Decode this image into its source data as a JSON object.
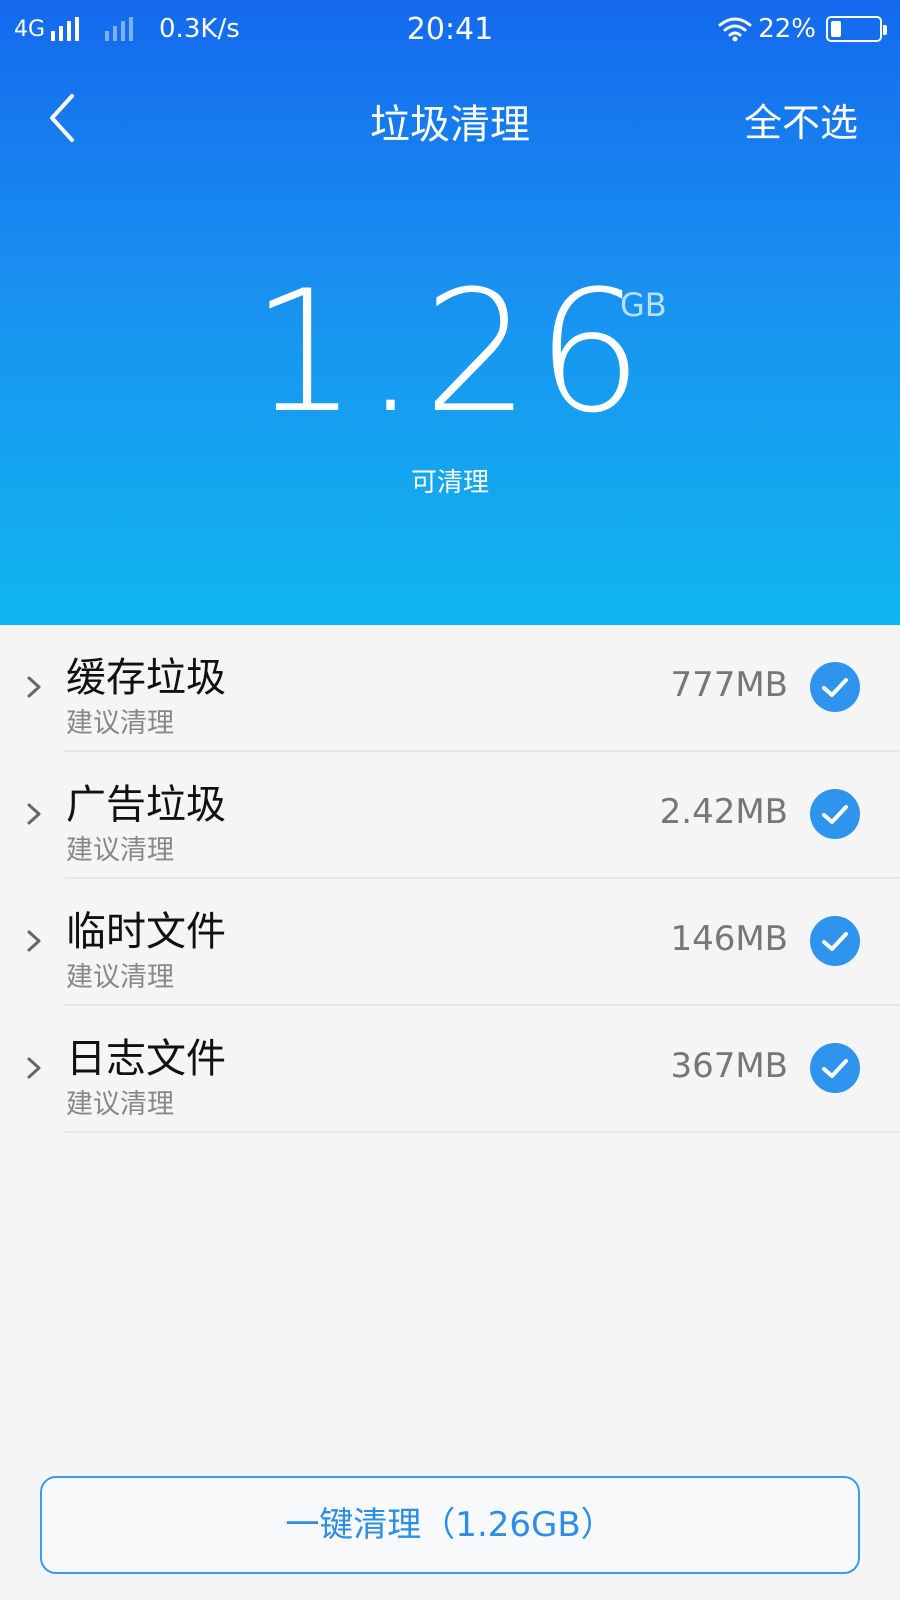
{
  "status_bar": {
    "network": "4G",
    "speed": "0.3K/s",
    "time": "20:41",
    "battery": "22%",
    "battery_level": 0.22,
    "icons": [
      "signal-icon",
      "signal-icon",
      "wifi-icon",
      "battery-icon"
    ]
  },
  "header": {
    "title": "垃圾清理",
    "action": "全不选",
    "back_icon": "back-arrow-icon"
  },
  "summary": {
    "amount": "1.26",
    "unit": "GB",
    "caption": "可清理"
  },
  "items": [
    {
      "name": "缓存垃圾",
      "sub": "建议清理",
      "size": "777MB",
      "checked": true
    },
    {
      "name": "广告垃圾",
      "sub": "建议清理",
      "size": "2.42MB",
      "checked": true
    },
    {
      "name": "临时文件",
      "sub": "建议清理",
      "size": "146MB",
      "checked": true
    },
    {
      "name": "日志文件",
      "sub": "建议清理",
      "size": "367MB",
      "checked": true
    }
  ],
  "clean_button": {
    "label": "一键清理（1.26GB）"
  },
  "colors": {
    "accent": "#2f94ee",
    "hero_top": "#1469ee",
    "hero_bottom": "#10b6ef"
  }
}
